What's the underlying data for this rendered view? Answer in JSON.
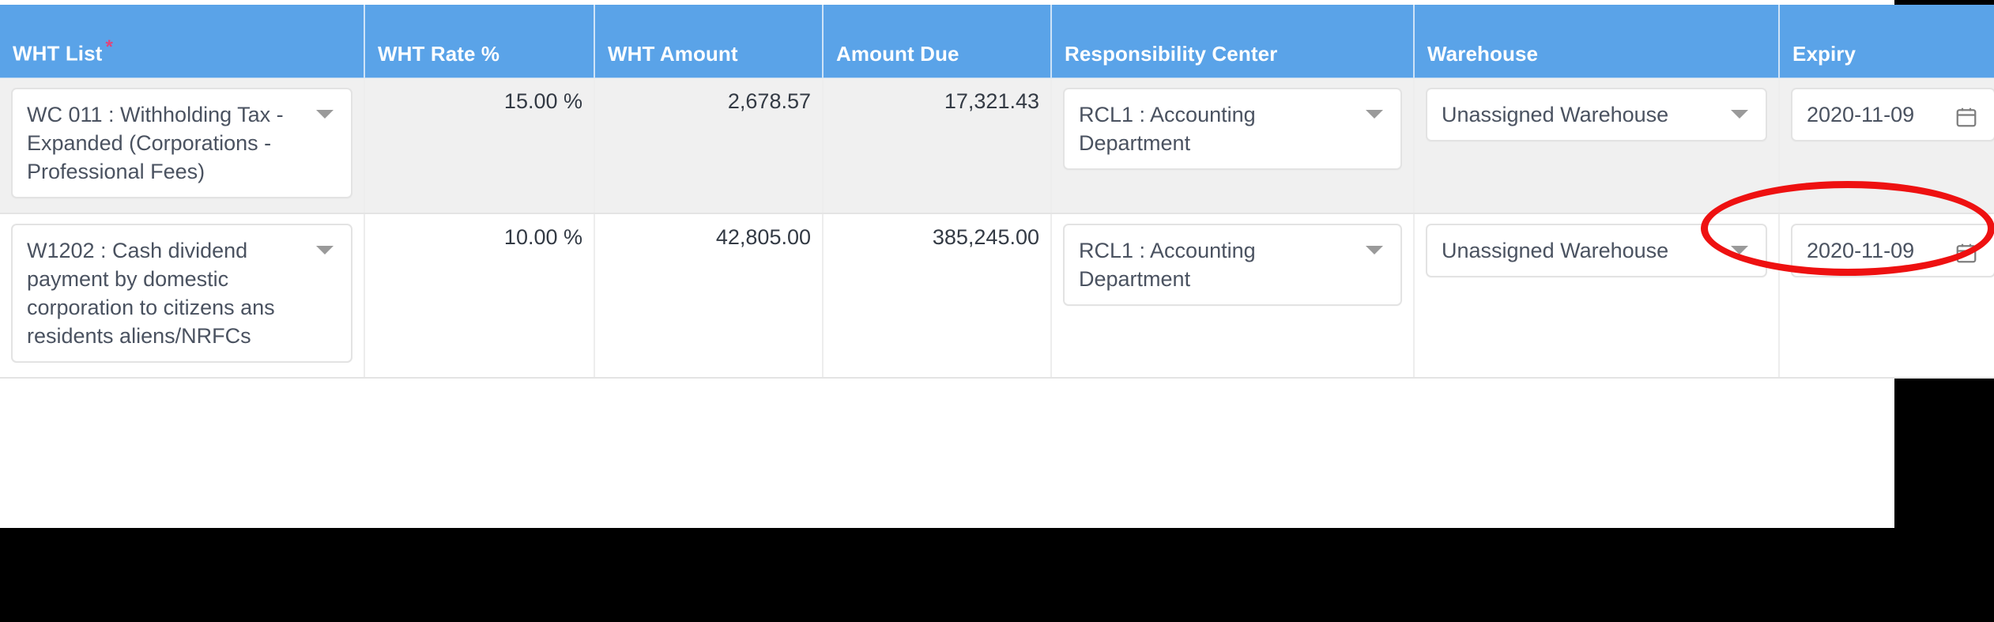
{
  "table": {
    "columns": [
      {
        "key": "wht_list",
        "label": "WHT List",
        "required": true,
        "required_marker": "*"
      },
      {
        "key": "wht_rate",
        "label": "WHT Rate %",
        "required": false
      },
      {
        "key": "wht_amount",
        "label": "WHT Amount",
        "required": false
      },
      {
        "key": "amount_due",
        "label": "Amount Due",
        "required": false
      },
      {
        "key": "resp_center",
        "label": "Responsibility Center",
        "required": false
      },
      {
        "key": "warehouse",
        "label": "Warehouse",
        "required": false
      },
      {
        "key": "expiry",
        "label": "Expiry",
        "required": false
      },
      {
        "key": "action",
        "label": "",
        "required": false
      }
    ],
    "rows": [
      {
        "wht_list": "WC 011 : Withholding Tax - Expanded (Corporations - Professional Fees)",
        "wht_rate": "15.00 %",
        "wht_amount": "2,678.57",
        "amount_due": "17,321.43",
        "resp_center": "RCL1 : Accounting Department",
        "warehouse": "Unassigned Warehouse",
        "expiry": "2020-11-09",
        "has_remove_button": false
      },
      {
        "wht_list": "W1202 : Cash dividend payment by domestic corporation to citizens ans residents aliens/NRFCs",
        "wht_rate": "10.00 %",
        "wht_amount": "42,805.00",
        "amount_due": "385,245.00",
        "resp_center": "RCL1 : Accounting Department",
        "warehouse": "Unassigned Warehouse",
        "expiry": "2020-11-09",
        "has_remove_button": true
      }
    ]
  },
  "icons": {
    "dropdown_caret": "chevron-down-icon",
    "calendar": "calendar-icon",
    "remove": "minus-icon"
  },
  "annotation": {
    "shape": "ellipse",
    "color": "#ee1111",
    "targets": "remove-row-button"
  },
  "colors": {
    "header_bg": "#5aa3e8",
    "header_text": "#ffffff",
    "required_star": "#e0457b",
    "row_odd_bg": "#f0f0f0",
    "row_even_bg": "#ffffff",
    "remove_button": "#f4543c",
    "annotation": "#ee1111"
  }
}
